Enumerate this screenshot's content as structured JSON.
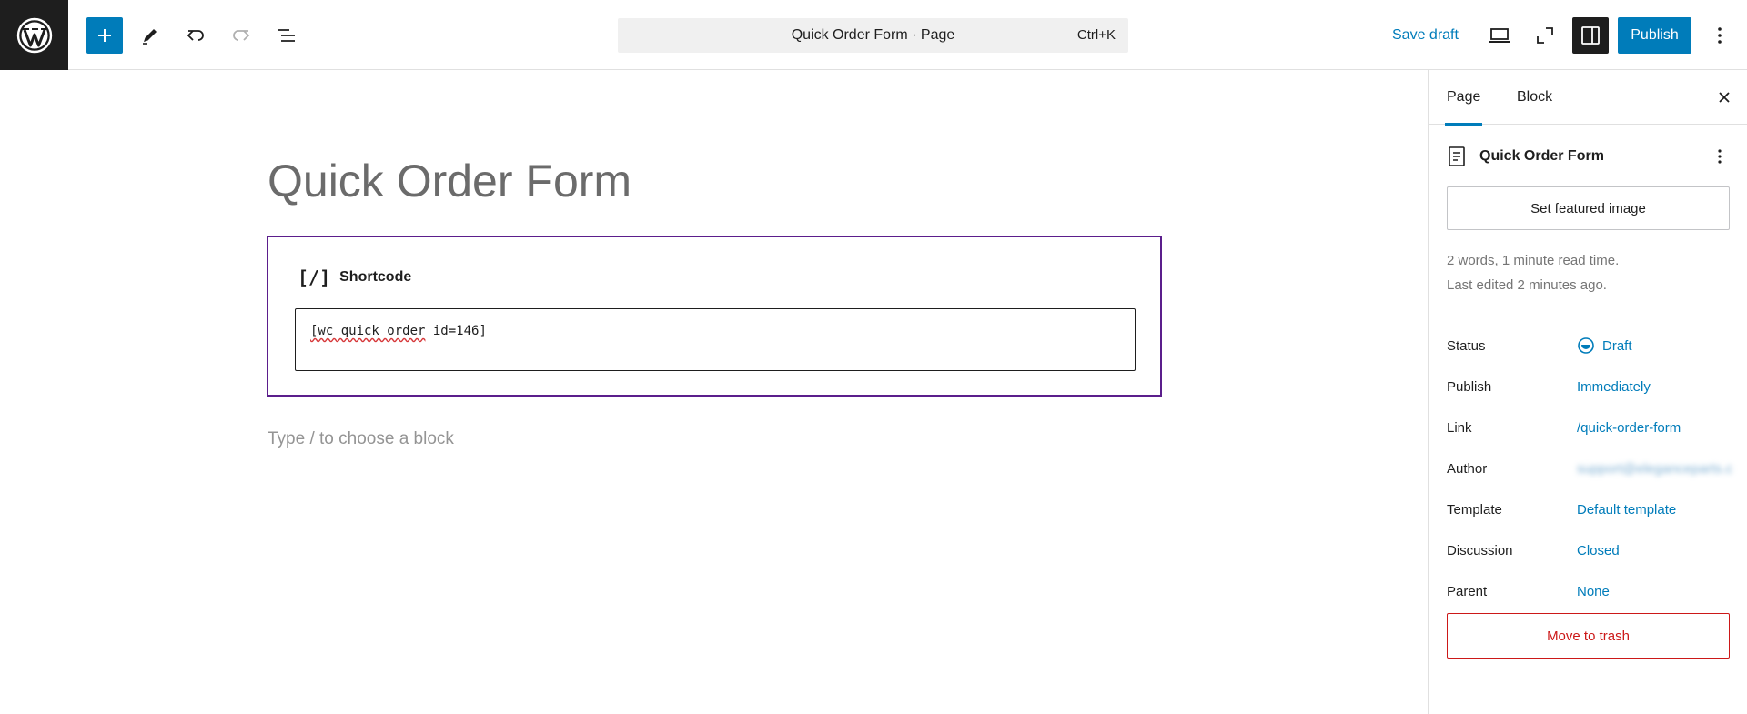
{
  "toolbar": {
    "command_title": "Quick Order Form · Page",
    "command_shortcut": "Ctrl+K",
    "save_draft_label": "Save draft",
    "publish_label": "Publish",
    "accent_color": "#007cba"
  },
  "editor": {
    "page_title": "Quick Order Form",
    "block_label": "Shortcode",
    "block_icon": "[/]",
    "shortcode_value_a": "[wc quick order",
    "shortcode_value_b": " id=146]",
    "block_placeholder": "Type / to choose a block"
  },
  "sidebar": {
    "tab_page": "Page",
    "tab_block": "Block",
    "doc_title": "Quick Order Form",
    "featured_image_label": "Set featured image",
    "meta_words": "2 words, 1 minute read time.",
    "meta_edited": "Last edited 2 minutes ago.",
    "rows": [
      {
        "label": "Status",
        "value": "Draft"
      },
      {
        "label": "Publish",
        "value": "Immediately"
      },
      {
        "label": "Link",
        "value": "/quick-order-form"
      },
      {
        "label": "Author",
        "value": "support@eleganceparts.c"
      },
      {
        "label": "Template",
        "value": "Default template"
      },
      {
        "label": "Discussion",
        "value": "Closed"
      },
      {
        "label": "Parent",
        "value": "None"
      }
    ],
    "trash_label": "Move to trash"
  }
}
